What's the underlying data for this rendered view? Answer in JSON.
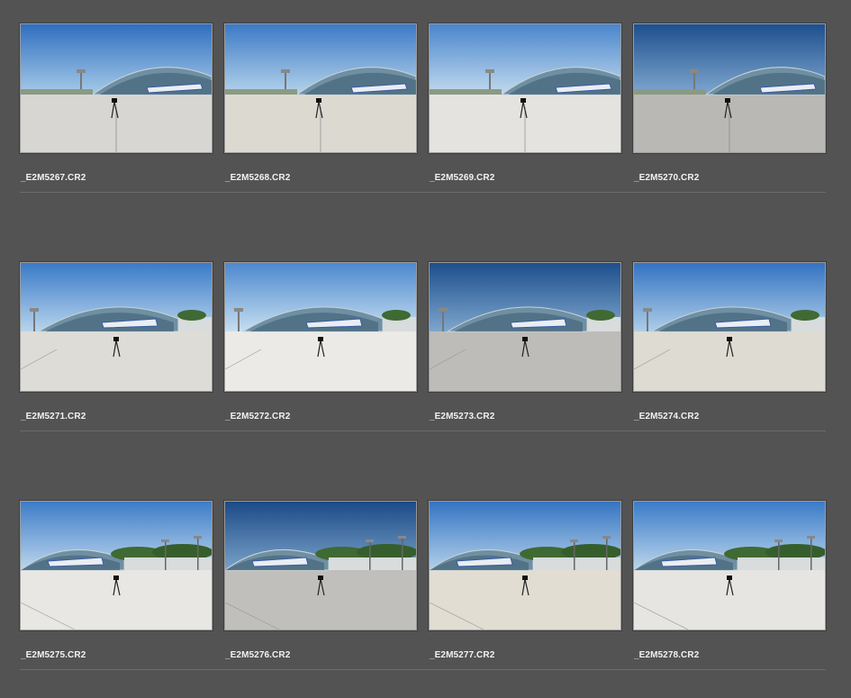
{
  "browser": {
    "thumbnails": [
      {
        "filename": "_E2M5267.CR2",
        "sky_top": "#2f6fc0",
        "sky_bottom": "#a7cbe8",
        "ground": "#d7d6d2",
        "view": "wide"
      },
      {
        "filename": "_E2M5268.CR2",
        "sky_top": "#3c7ac6",
        "sky_bottom": "#b5d3ea",
        "ground": "#dcd9d1",
        "view": "wide"
      },
      {
        "filename": "_E2M5269.CR2",
        "sky_top": "#4a86cc",
        "sky_bottom": "#c2daee",
        "ground": "#e4e3e0",
        "view": "wide"
      },
      {
        "filename": "_E2M5270.CR2",
        "sky_top": "#1e4f8e",
        "sky_bottom": "#7fa7cf",
        "ground": "#b9b8b5",
        "view": "wide"
      },
      {
        "filename": "_E2M5271.CR2",
        "sky_top": "#3a7ac8",
        "sky_bottom": "#b7d4ec",
        "ground": "#dedcd6",
        "view": "mid"
      },
      {
        "filename": "_E2M5272.CR2",
        "sky_top": "#4c88cf",
        "sky_bottom": "#c6def0",
        "ground": "#ebeae7",
        "view": "mid"
      },
      {
        "filename": "_E2M5273.CR2",
        "sky_top": "#1d4f8c",
        "sky_bottom": "#7ea6cd",
        "ground": "#bdbcb9",
        "view": "mid"
      },
      {
        "filename": "_E2M5274.CR2",
        "sky_top": "#3373c2",
        "sky_bottom": "#aecde8",
        "ground": "#dedbd2",
        "view": "mid"
      },
      {
        "filename": "_E2M5275.CR2",
        "sky_top": "#3d7cc8",
        "sky_bottom": "#bcd6ec",
        "ground": "#e8e7e3",
        "view": "side"
      },
      {
        "filename": "_E2M5276.CR2",
        "sky_top": "#1b4a86",
        "sky_bottom": "#7aa2c9",
        "ground": "#c0bfbc",
        "view": "side"
      },
      {
        "filename": "_E2M5277.CR2",
        "sky_top": "#3574c2",
        "sky_bottom": "#b2d0ea",
        "ground": "#e1ddd2",
        "view": "side"
      },
      {
        "filename": "_E2M5278.CR2",
        "sky_top": "#3b7bc8",
        "sky_bottom": "#bbd6ec",
        "ground": "#e6e5e1",
        "view": "side"
      }
    ]
  }
}
